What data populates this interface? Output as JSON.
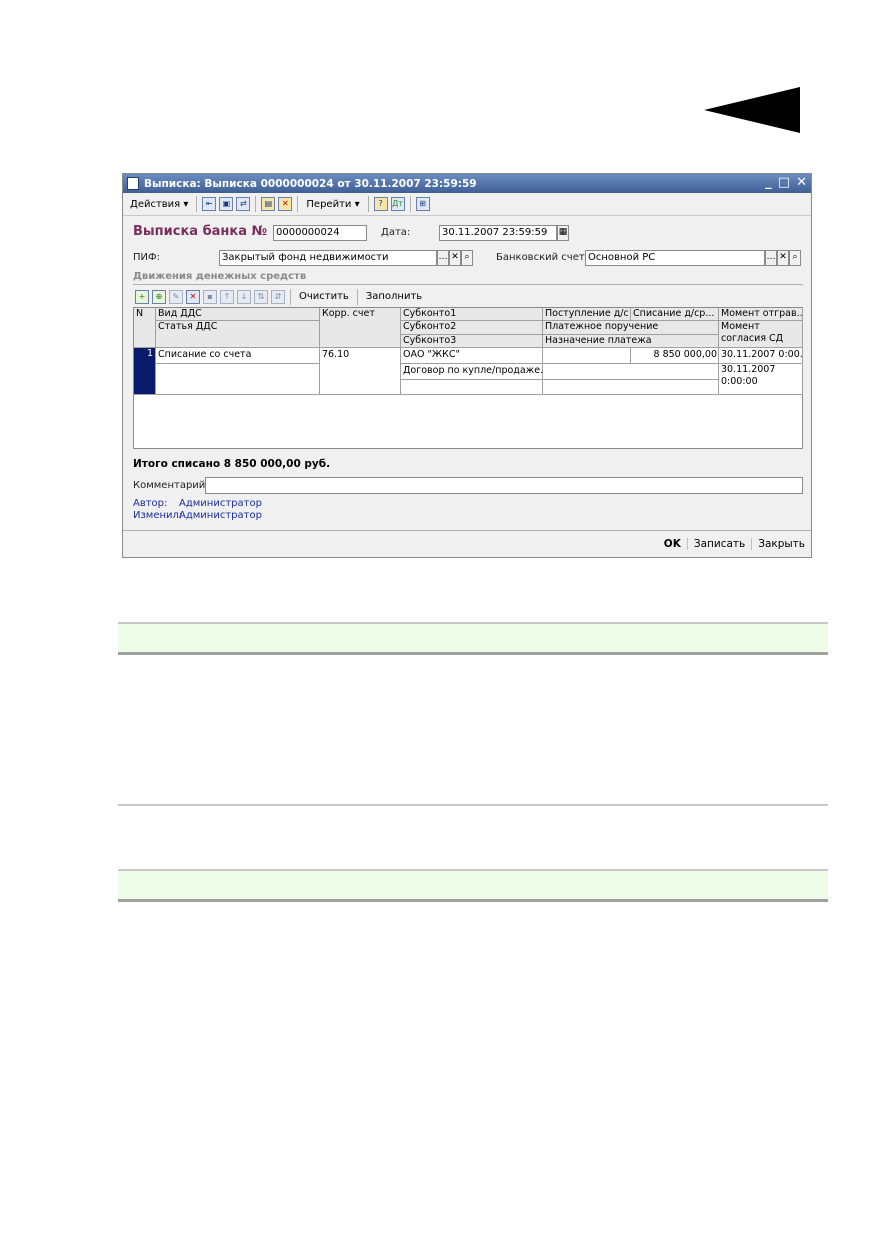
{
  "window": {
    "title": "Выписка: Выписка 0000000024 от 30.11.2007 23:59:59",
    "controls": [
      "_",
      "□",
      "✕"
    ]
  },
  "toolbar": {
    "actions_label": "Действия",
    "goto_label": "Перейти",
    "help_icon": "?"
  },
  "form": {
    "heading": "Выписка банка №",
    "number": "0000000024",
    "date_label": "Дата:",
    "date": "30.11.2007 23:59:59",
    "pif_label": "ПИФ:",
    "pif_value": "Закрытый фонд недвижимости",
    "bank_account_label": "Банковский счет:",
    "bank_account_value": "Основной РС",
    "section_title": "Движения денежных средств",
    "clear_label": "Очистить",
    "fill_label": "Заполнить"
  },
  "grid": {
    "headers": {
      "n": "N",
      "vid_dds": "Вид ДДС",
      "statya_dds": "Статья ДДС",
      "korr_schet": "Корр. счет",
      "subkonto1": "Субконто1",
      "subkonto2": "Субконто2",
      "subkonto3": "Субконто3",
      "postuplenie": "Поступление д/с",
      "spisanie": "Списание д/ср...",
      "platezhnoe": "Платежное поручение",
      "naznachenie": "Назначение платежа",
      "moment_otgr": "Момент отграв...",
      "moment_sogl": "Момент согласия СД"
    },
    "row": {
      "n": "1",
      "vid_dds": "Списание со счета",
      "korr_schet": "76.10",
      "subkonto1": "ОАО \"ЖКС\"",
      "subkonto2": "Договор по купле/продаже...",
      "spisanie": "8 850 000,00",
      "moment_otgr": "30.11.2007 0:00...",
      "moment_sogl_1": "30.11.2007",
      "moment_sogl_2": "0:00:00"
    }
  },
  "summary": {
    "total": "Итого списано 8 850 000,00 руб.",
    "comment_label": "Комментарий:",
    "author_label": "Автор:",
    "author": "Администратор",
    "changed_label": "Изменил:",
    "changed": "Администратор"
  },
  "footer": {
    "ok": "OK",
    "save": "Записать",
    "close": "Закрыть"
  },
  "colors": {
    "heading": "#7a2f5a",
    "link": "#1a2f9a",
    "band": "#eefde8"
  }
}
